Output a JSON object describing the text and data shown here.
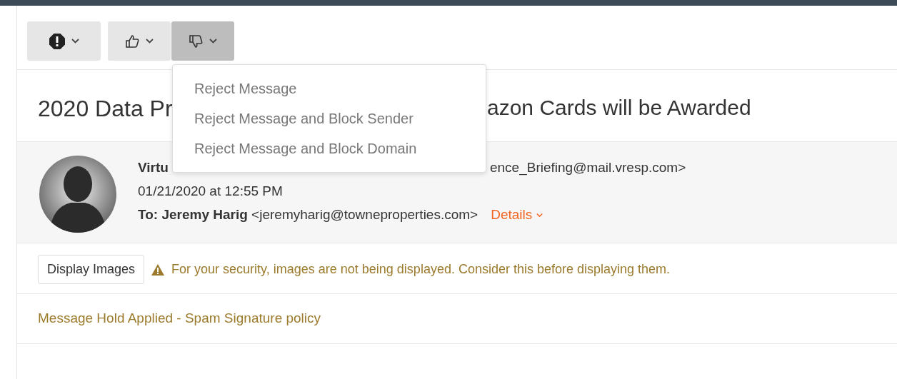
{
  "toolbar": [
    {
      "kind": "alert",
      "expanded": false
    },
    {
      "kind": "thumbs-up",
      "expanded": false
    },
    {
      "kind": "thumbs-down",
      "expanded": true
    }
  ],
  "menu": {
    "items": [
      {
        "label": "Reject Message"
      },
      {
        "label": "Reject Message and Block Sender"
      },
      {
        "label": "Reject Message and Block Domain"
      }
    ]
  },
  "subject": {
    "visible_start": "2020 Data Pr",
    "visible_end": "azon Cards will be Awarded"
  },
  "header": {
    "from_start": "Virtu",
    "from_end": "ence_Briefing@mail.vresp.com>",
    "date": "01/21/2020 at 12:55 PM",
    "to_label": "To:",
    "to_name": "Jeremy Harig",
    "to_address": "<jeremyharig@towneproperties.com>",
    "details": "Details"
  },
  "images_bar": {
    "button": "Display Images",
    "warning": "For your security, images are not being displayed. Consider this before displaying them."
  },
  "hold_notice": "Message Hold Applied - Spam Signature policy"
}
